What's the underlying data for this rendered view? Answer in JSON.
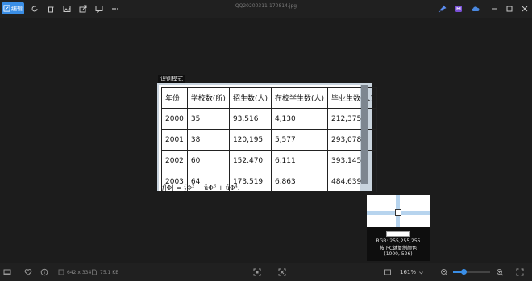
{
  "toolbar": {
    "edit_label": "编辑",
    "file_title": "QQ20200311-170814.jpg"
  },
  "mode_label": "识别模式",
  "table": {
    "headers": [
      "年份",
      "学校数(所)",
      "招生数(人)",
      "在校学生数(人)",
      "毕业生数(人)"
    ],
    "rows": [
      [
        "2000",
        "35",
        "93,516",
        "4,130",
        "212,375"
      ],
      [
        "2001",
        "38",
        "120,195",
        "5,577",
        "293,078"
      ],
      [
        "2002",
        "60",
        "152,470",
        "6,111",
        "393,145"
      ],
      [
        "2003",
        "64",
        "173,519",
        "6,863",
        "484,639"
      ]
    ]
  },
  "formula": {
    "lead": "f",
    "abs": "|Φ|",
    "eq": " = ",
    "frac_num": "r",
    "frac_den": "2",
    "term1": "Φ",
    "exp1": "2",
    "minus": " − ",
    "term2": "ūΦ",
    "exp2": "3",
    "plus": " + ",
    "term3": "ūΦ",
    "exp3": "4",
    "end": "."
  },
  "magnifier": {
    "rgb": "RGB: 255,255,255",
    "hint": "按下C键复制颜色",
    "coords": "(1000, 526)"
  },
  "statusbar": {
    "dimensions": "642 x 334",
    "filesize": "75.1 KB",
    "zoom": "161%",
    "zoom_level": 0.3
  },
  "colors": {
    "accent": "#3a8ee6"
  }
}
